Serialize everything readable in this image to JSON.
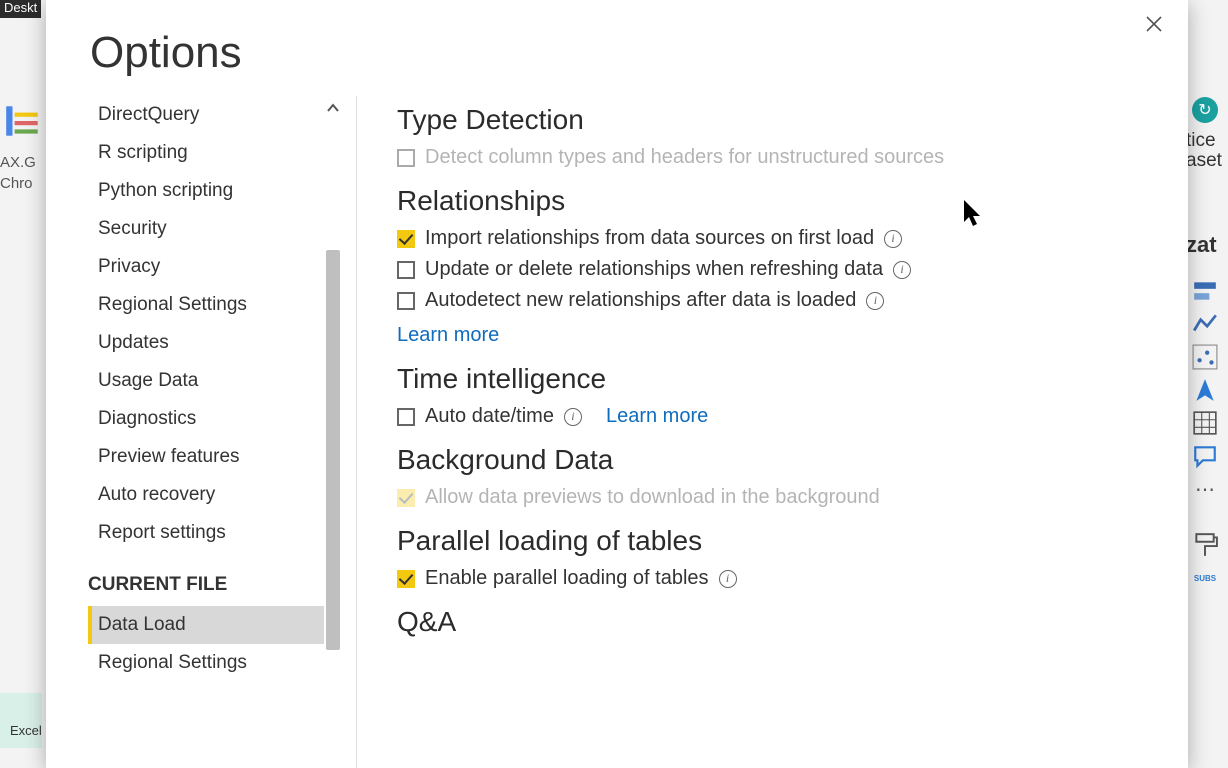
{
  "bg": {
    "title": "Deskt",
    "left_line1": "AX.G",
    "left_line2": "Chro",
    "excel": "Excel",
    "right_top": "tice",
    "right_top2": "aset",
    "right_viz": "zat"
  },
  "dialog": {
    "title": "Options"
  },
  "sidebar": {
    "items": [
      "DirectQuery",
      "R scripting",
      "Python scripting",
      "Security",
      "Privacy",
      "Regional Settings",
      "Updates",
      "Usage Data",
      "Diagnostics",
      "Preview features",
      "Auto recovery",
      "Report settings"
    ],
    "section": "CURRENT FILE",
    "cf_items": [
      "Data Load",
      "Regional Settings"
    ],
    "selected": "Data Load"
  },
  "content": {
    "type_detection": {
      "heading": "Type Detection",
      "opt1": "Detect column types and headers for unstructured sources"
    },
    "relationships": {
      "heading": "Relationships",
      "opt1": "Import relationships from data sources on first load",
      "opt2": "Update or delete relationships when refreshing data",
      "opt3": "Autodetect new relationships after data is loaded",
      "learn": "Learn more"
    },
    "time_intel": {
      "heading": "Time intelligence",
      "opt1": "Auto date/time",
      "learn": "Learn more"
    },
    "background": {
      "heading": "Background Data",
      "opt1": "Allow data previews to download in the background"
    },
    "parallel": {
      "heading": "Parallel loading of tables",
      "opt1": "Enable parallel loading of tables"
    },
    "qa": {
      "heading": "Q&A"
    }
  }
}
